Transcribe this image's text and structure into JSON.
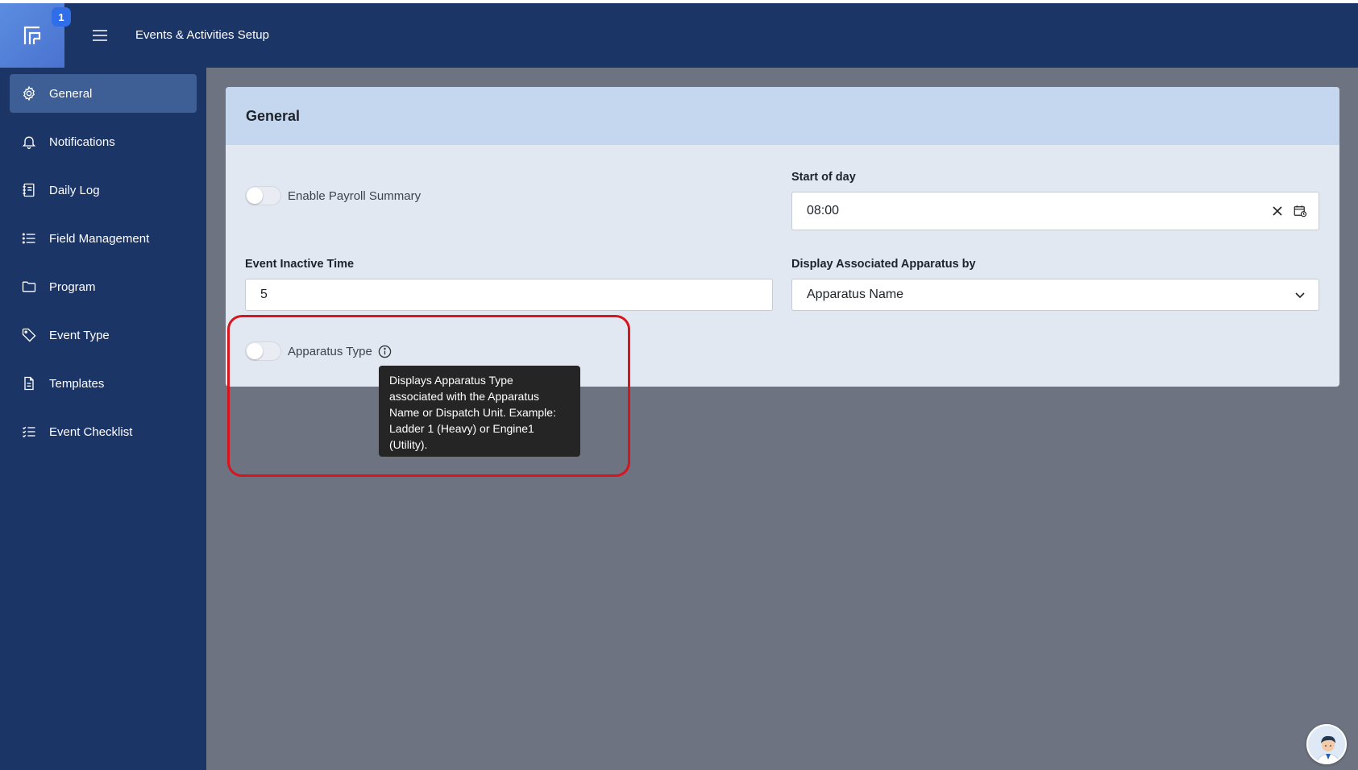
{
  "header": {
    "logo_badge": "1",
    "title": "Events & Activities Setup"
  },
  "sidebar": {
    "items": [
      {
        "label": "General",
        "icon": "gear-icon",
        "active": true
      },
      {
        "label": "Notifications",
        "icon": "bell-icon"
      },
      {
        "label": "Daily Log",
        "icon": "log-book-icon"
      },
      {
        "label": "Field Management",
        "icon": "list-icon"
      },
      {
        "label": "Program",
        "icon": "folder-icon"
      },
      {
        "label": "Event Type",
        "icon": "tag-icon"
      },
      {
        "label": "Templates",
        "icon": "document-icon"
      },
      {
        "label": "Event Checklist",
        "icon": "checklist-icon"
      }
    ]
  },
  "card": {
    "title": "General",
    "payroll_toggle_label": "Enable Payroll Summary",
    "start_of_day_label": "Start of day",
    "start_of_day_value": "08:00",
    "event_inactive_label": "Event Inactive Time",
    "event_inactive_value": "5",
    "display_apparatus_label": "Display Associated Apparatus by",
    "display_apparatus_value": "Apparatus Name",
    "apparatus_type_label": "Apparatus Type"
  },
  "tooltip": {
    "text": "Displays Apparatus Type associated with the Apparatus Name or Dispatch Unit. Example: Ladder 1 (Heavy) or Engine1 (Utility)."
  },
  "colors": {
    "topbar": "#1c3567",
    "sidebar_active": "#3e5f95",
    "card_header": "#c5d6ef",
    "highlight": "#d8141c"
  }
}
